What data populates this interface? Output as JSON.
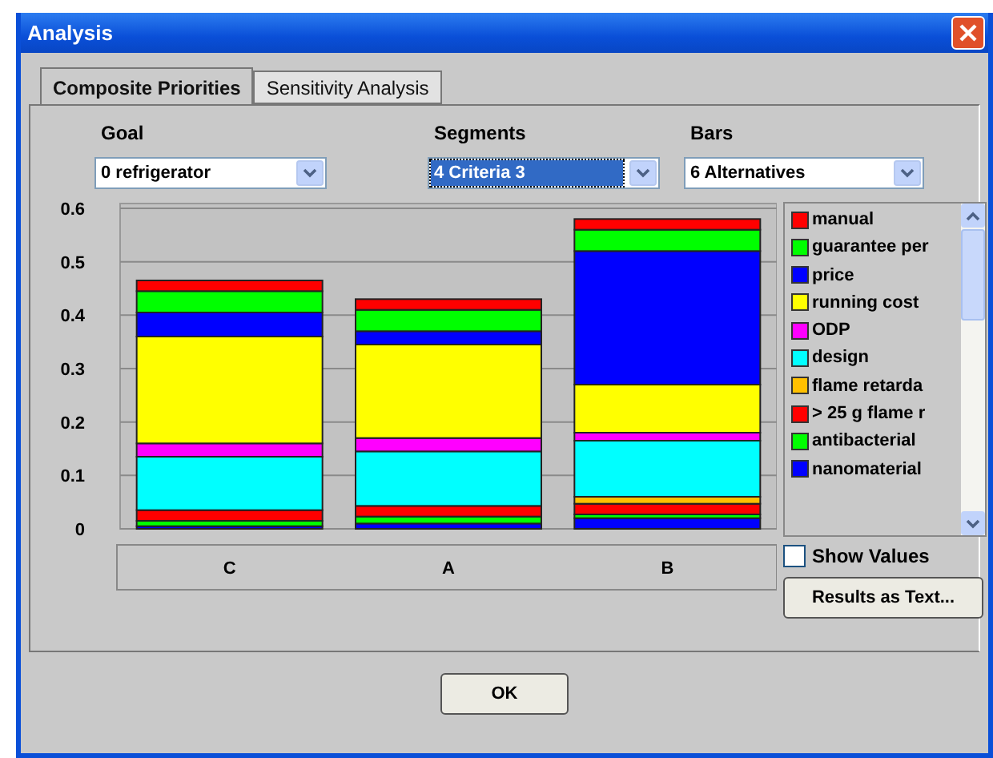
{
  "window": {
    "title": "Analysis"
  },
  "tabs": [
    {
      "label": "Composite Priorities",
      "selected": true
    },
    {
      "label": "Sensitivity Analysis",
      "selected": false
    }
  ],
  "selectors": [
    {
      "label": "Goal",
      "value": "0 refrigerator",
      "focused": false
    },
    {
      "label": "Segments",
      "value": "4 Criteria 3",
      "focused": true
    },
    {
      "label": "Bars",
      "value": "6 Alternatives",
      "focused": false
    }
  ],
  "chart_data": {
    "type": "bar",
    "stacked": true,
    "grid": true,
    "categories": [
      "C",
      "A",
      "B"
    ],
    "ylim": [
      0,
      0.6
    ],
    "yticks": [
      {
        "value": 0,
        "label": "0"
      },
      0.1,
      0.2,
      0.3,
      0.4,
      0.5,
      0.6
    ],
    "series": [
      {
        "name": "nanomaterial",
        "color": "#0000ff",
        "values": [
          0.005,
          0.01,
          0.02
        ]
      },
      {
        "name": "antibacterial",
        "color": "#00ff00",
        "values": [
          0.01,
          0.013,
          0.007
        ]
      },
      {
        "name": "> 25 g flame r",
        "color": "#ff0000",
        "values": [
          0.02,
          0.02,
          0.02
        ]
      },
      {
        "name": "flame retarda",
        "color": "#ffc000",
        "values": [
          0,
          0,
          0.013
        ]
      },
      {
        "name": "design",
        "color": "#00ffff",
        "values": [
          0.1,
          0.102,
          0.105
        ]
      },
      {
        "name": "ODP",
        "color": "#ff00ff",
        "values": [
          0.025,
          0.025,
          0.015
        ]
      },
      {
        "name": "running cost",
        "color": "#ffff00",
        "values": [
          0.2,
          0.175,
          0.09
        ]
      },
      {
        "name": "price",
        "color": "#0000ff",
        "values": [
          0.045,
          0.025,
          0.25
        ]
      },
      {
        "name": "guarantee per",
        "color": "#00ff00",
        "values": [
          0.04,
          0.04,
          0.04
        ]
      },
      {
        "name": "manual",
        "color": "#ff0000",
        "values": [
          0.02,
          0.02,
          0.02
        ]
      }
    ]
  },
  "show_values": {
    "label": "Show Values",
    "checked": false
  },
  "buttons": [
    {
      "label": "Results as Text..."
    },
    {
      "label": "OK"
    }
  ]
}
